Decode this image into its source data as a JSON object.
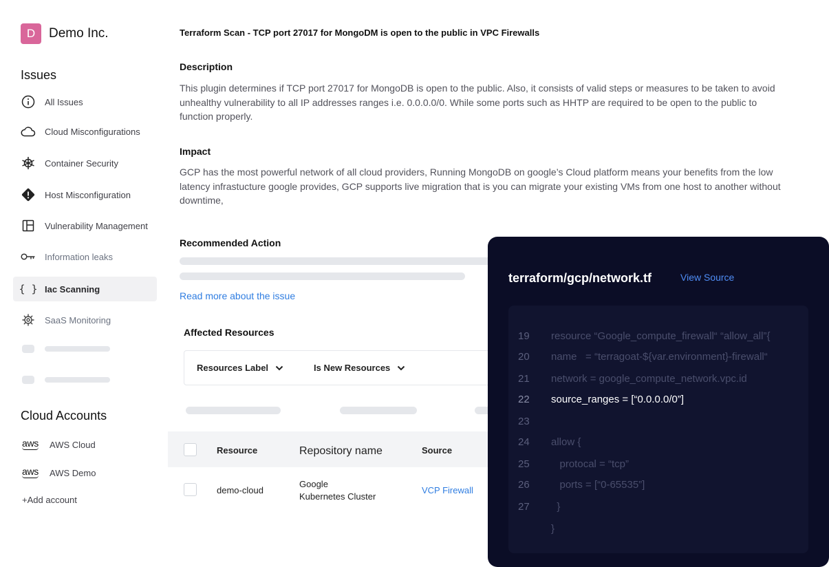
{
  "org": {
    "initial": "D",
    "name": "Demo Inc."
  },
  "sidebar": {
    "issues_title": "Issues",
    "items": [
      {
        "label": "All Issues",
        "icon": "info-icon"
      },
      {
        "label": "Cloud Misconfigurations",
        "icon": "cloud-icon"
      },
      {
        "label": "Container Security",
        "icon": "helm-icon"
      },
      {
        "label": "Host Misconfiguration",
        "icon": "warning-diamond-icon"
      },
      {
        "label": "Vulnerability Management",
        "icon": "layout-icon"
      },
      {
        "label": "Information leaks",
        "icon": "key-icon"
      },
      {
        "label": "Iac Scanning",
        "icon": "braces-icon",
        "active": true
      },
      {
        "label": "SaaS Monitoring",
        "icon": "gear-cog-icon"
      }
    ],
    "accounts_title": "Cloud Accounts",
    "accounts": [
      {
        "logo": "aws",
        "label": "AWS Cloud"
      },
      {
        "logo": "aws",
        "label": "AWS Demo"
      }
    ],
    "add_account": "+Add account"
  },
  "issue": {
    "title": "Terraform Scan - TCP port 27017 for MongoDM is open to the public in VPC Firewalls",
    "description_heading": "Description",
    "description": "This plugin determines if TCP port 27017 for MongoDB is open to the public. Also, it consists of valid steps or measures to be taken to avoid unhealthy vulnerability to all IP addresses ranges i.e. 0.0.0.0/0. While some ports such as HHTP are required to be open to the public to function properly.",
    "impact_heading": "Impact",
    "impact": "GCP has the most powerful network of all cloud providers, Running MongoDB on google’s Cloud platform means your benefits from the low latency infrastucture google provides, GCP supports live migration that is you can migrate your existing VMs from one host to another without downtime,",
    "recommended_heading": "Recommended Action",
    "read_more": "Read more about the issue",
    "affected_heading": "Affected Resources"
  },
  "filters": {
    "resources_label": "Resources Label",
    "is_new": "Is New Resources"
  },
  "table": {
    "headers": {
      "resource": "Resource",
      "repo": "Repository name",
      "source": "Source"
    },
    "rows": [
      {
        "resource": "demo-cloud",
        "repo_line1": "Google",
        "repo_line2": "Kubernetes Cluster",
        "source": "VCP Firewall"
      }
    ]
  },
  "code": {
    "file": "terraform/gcp/network.tf",
    "view_source": "View Source",
    "lines": [
      {
        "n": "19",
        "text": "resource “Google_compute_firewall“ “allow_all”{"
      },
      {
        "n": "20",
        "text": "name   = “terragoat-${var.environment}-firewall“"
      },
      {
        "n": "21",
        "text": "network = google_compute_network.vpc.id"
      },
      {
        "n": "22",
        "text": "source_ranges = [“0.0.0.0/0”]",
        "highlight": true
      },
      {
        "n": "23",
        "text": ""
      },
      {
        "n": "24",
        "text": "allow {"
      },
      {
        "n": "25",
        "text": "   protocal = “tcp”"
      },
      {
        "n": "26",
        "text": "   ports = [“0-65535”]"
      },
      {
        "n": "27",
        "text": "  }"
      },
      {
        "n": "",
        "text": "}"
      }
    ]
  },
  "colors": {
    "brand": "#d9669a",
    "link": "#2f7de1",
    "code_bg": "#0b0d26",
    "code_link": "#4f8df5"
  }
}
